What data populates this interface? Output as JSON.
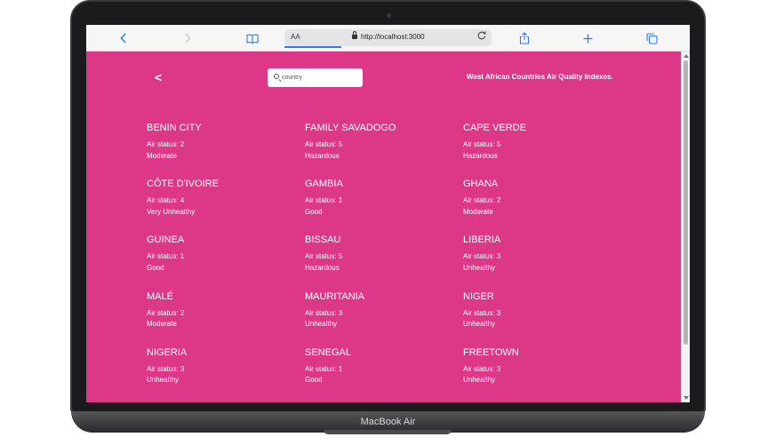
{
  "device": {
    "label": "MacBook Air"
  },
  "browser": {
    "address": {
      "text_size": "AA",
      "url": "http://localhost:3000"
    },
    "buttons": {
      "back_icon": "chevron-left-icon",
      "forward_icon": "chevron-right-icon",
      "bookmarks_icon": "book-icon",
      "reload_icon": "reload-icon",
      "share_icon": "share-icon",
      "new_tab_icon": "plus-icon",
      "tabs_icon": "tabs-icon"
    }
  },
  "page": {
    "background": "#dd3887",
    "back_label": "<",
    "search": {
      "placeholder": "country"
    },
    "heading": "West African Countries Air Quality Indexes.",
    "countries": [
      {
        "name": "BENIN CITY",
        "status": "Air status: 2",
        "level": "Moderate"
      },
      {
        "name": "FAMILY SAVADOGO",
        "status": "Air status: 5",
        "level": "Hazardous"
      },
      {
        "name": "CAPE VERDE",
        "status": "Air status: 5",
        "level": "Hazardous"
      },
      {
        "name": "CÔTE D'IVOIRE",
        "status": "Air status: 4",
        "level": "Very Unhealthy"
      },
      {
        "name": "GAMBIA",
        "status": "Air status: 1",
        "level": "Good"
      },
      {
        "name": "GHANA",
        "status": "Air status: 2",
        "level": "Moderate"
      },
      {
        "name": "GUINEA",
        "status": "Air status: 1",
        "level": "Good"
      },
      {
        "name": "BISSAU",
        "status": "Air status: 5",
        "level": "Hazardous"
      },
      {
        "name": "LIBERIA",
        "status": "Air status: 3",
        "level": "Unhealthy"
      },
      {
        "name": "MALÉ",
        "status": "Air status: 2",
        "level": "Moderate"
      },
      {
        "name": "MAURITANIA",
        "status": "Air status: 3",
        "level": "Unhealthy"
      },
      {
        "name": "NIGER",
        "status": "Air status: 3",
        "level": "Unhealthy"
      },
      {
        "name": "NIGERIA",
        "status": "Air status: 3",
        "level": "Unhealthy"
      },
      {
        "name": "SENEGAL",
        "status": "Air status: 1",
        "level": "Good"
      },
      {
        "name": "FREETOWN",
        "status": "Air status: 3",
        "level": "Unhealthy"
      }
    ]
  }
}
